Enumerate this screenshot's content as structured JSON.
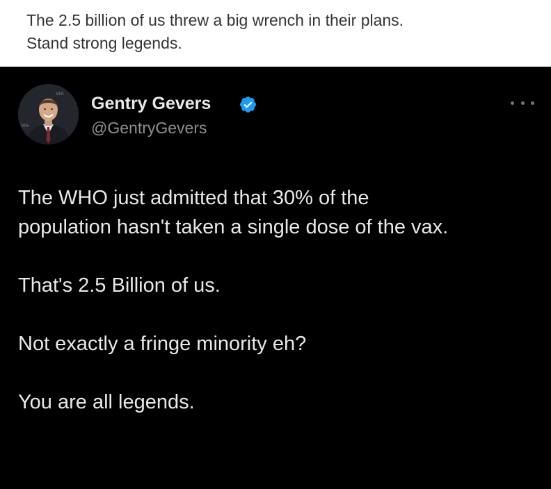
{
  "caption": {
    "line1": "The 2.5 billion of us threw a big wrench in their plans.",
    "line2": "Stand strong legends."
  },
  "tweet": {
    "author": {
      "display_name": "Gentry Gevers",
      "handle": "@GentryGevers",
      "verified": true
    },
    "body": {
      "para1_line1": "The WHO just admitted that 30% of the",
      "para1_line2": "population hasn't taken a single dose of the vax.",
      "para2": "That's 2.5 Billion of us.",
      "para3": "Not exactly a fringe minority eh?",
      "para4": "You are all legends."
    }
  },
  "colors": {
    "tweet_background": "#000000",
    "tweet_text": "#e7e9ea",
    "handle_text": "#8b9096",
    "verified_blue": "#1d9bf0",
    "caption_text": "#333333"
  },
  "icons": {
    "verified": "verified-check-icon",
    "more": "more-options-icon"
  }
}
